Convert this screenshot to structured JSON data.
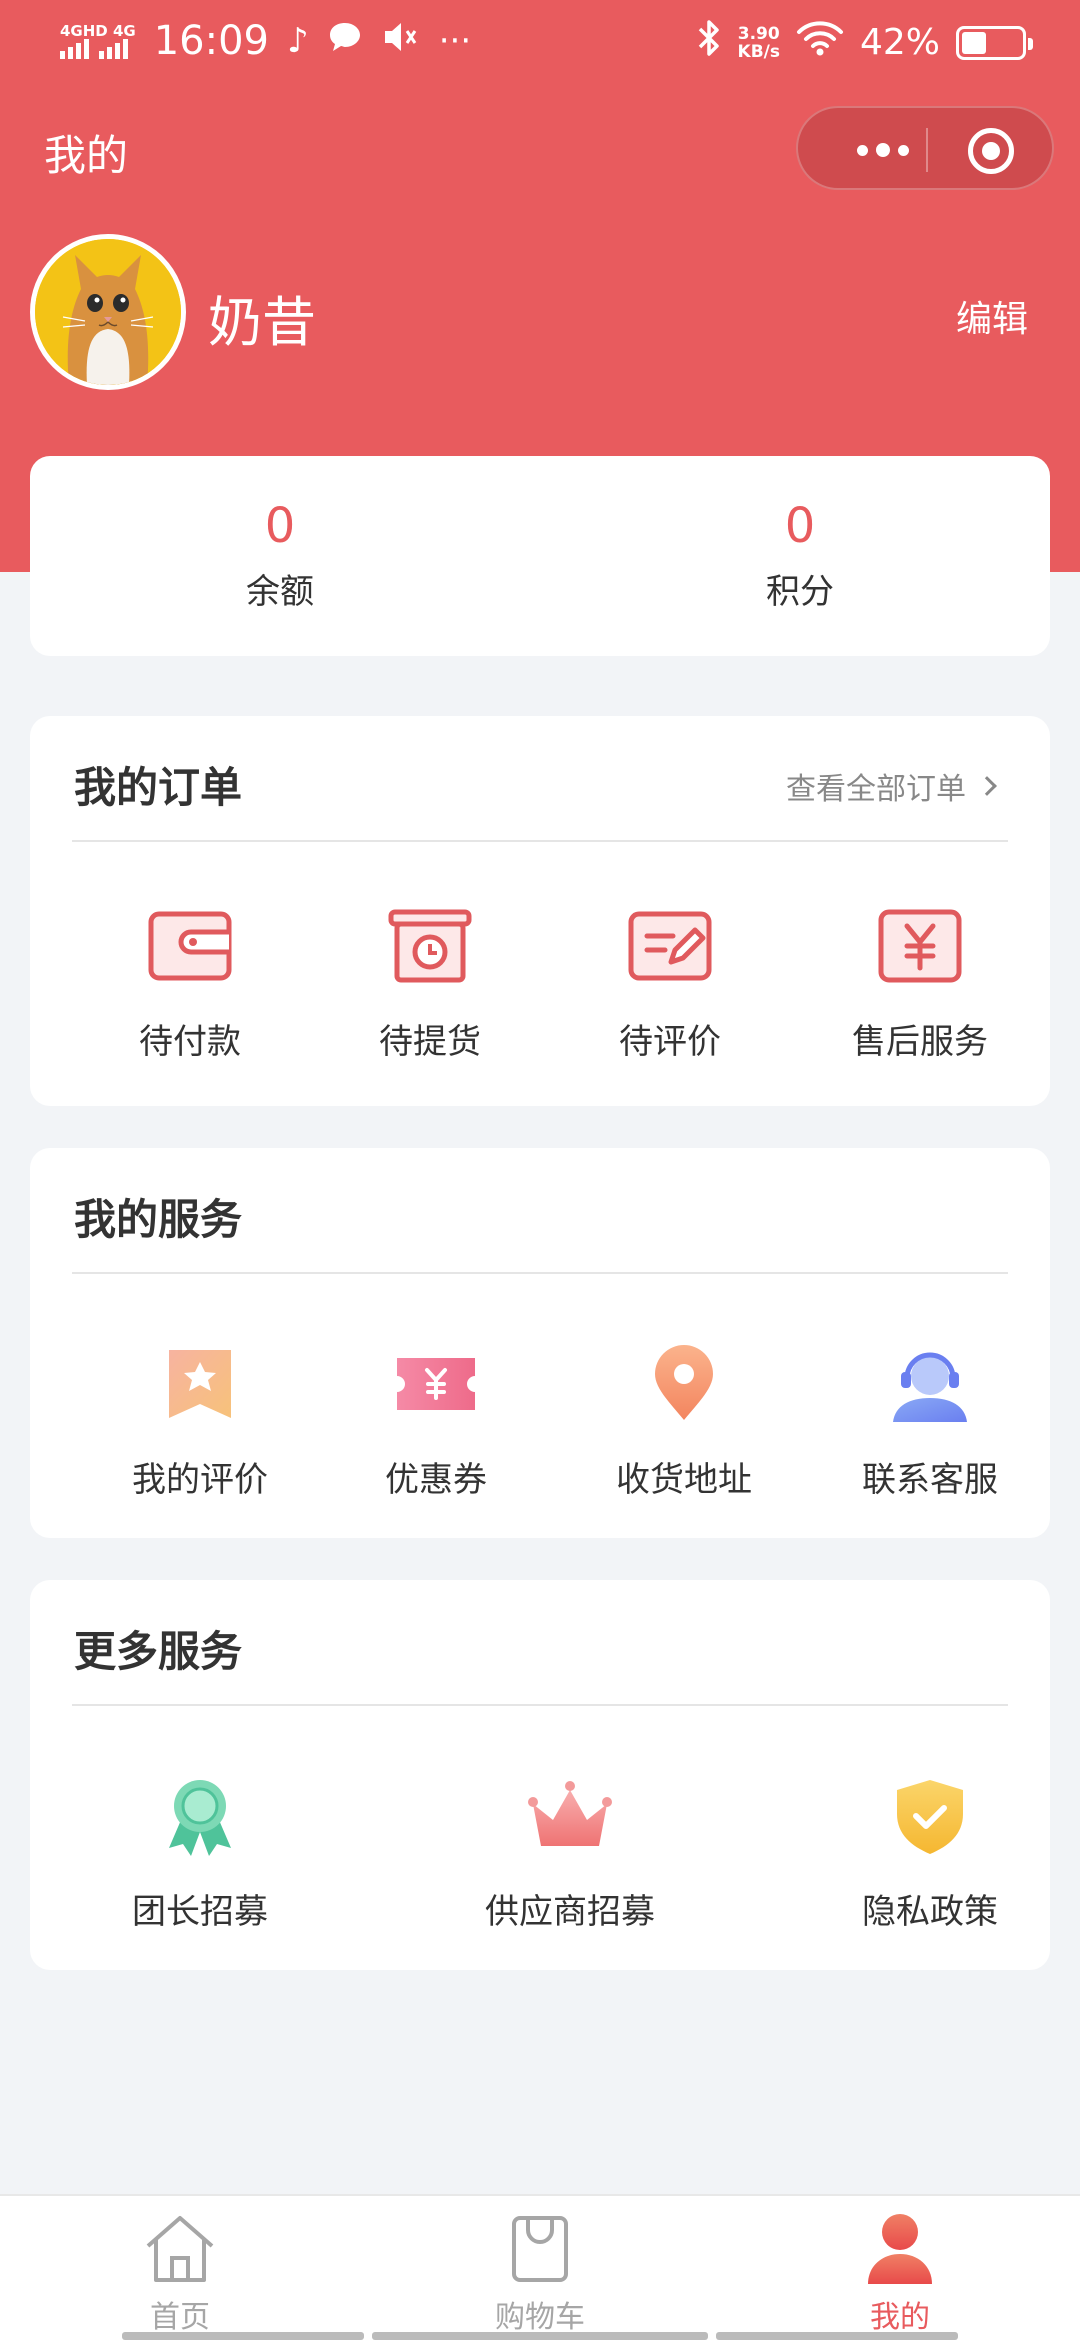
{
  "status_bar": {
    "network": "4GHD 4G",
    "time": "16:09",
    "speed_value": "3.90",
    "speed_unit": "KB/s",
    "battery": "42%"
  },
  "nav": {
    "title": "我的"
  },
  "profile": {
    "name": "奶昔",
    "edit_label": "编辑"
  },
  "stats": [
    {
      "value": "0",
      "label": "余额"
    },
    {
      "value": "0",
      "label": "积分"
    }
  ],
  "orders": {
    "title": "我的订单",
    "view_all": "查看全部订单",
    "items": [
      {
        "label": "待付款",
        "icon": "wallet-icon"
      },
      {
        "label": "待提货",
        "icon": "pickup-clock-icon"
      },
      {
        "label": "待评价",
        "icon": "edit-review-icon"
      },
      {
        "label": "售后服务",
        "icon": "yen-service-icon"
      }
    ]
  },
  "services": {
    "title": "我的服务",
    "items": [
      {
        "label": "我的评价",
        "icon": "star-bookmark-icon"
      },
      {
        "label": "优惠券",
        "icon": "coupon-icon"
      },
      {
        "label": "收货地址",
        "icon": "location-pin-icon"
      },
      {
        "label": "联系客服",
        "icon": "customer-service-icon"
      }
    ]
  },
  "more": {
    "title": "更多服务",
    "items": [
      {
        "label": "团长招募",
        "icon": "medal-icon"
      },
      {
        "label": "供应商招募",
        "icon": "crown-icon"
      },
      {
        "label": "隐私政策",
        "icon": "shield-check-icon"
      }
    ]
  },
  "tabs": [
    {
      "label": "首页",
      "icon": "home-icon"
    },
    {
      "label": "购物车",
      "icon": "shopping-bag-icon"
    },
    {
      "label": "我的",
      "icon": "user-icon",
      "active": true
    }
  ],
  "colors": {
    "primary": "#e85b5e",
    "background": "#f2f4f7"
  }
}
